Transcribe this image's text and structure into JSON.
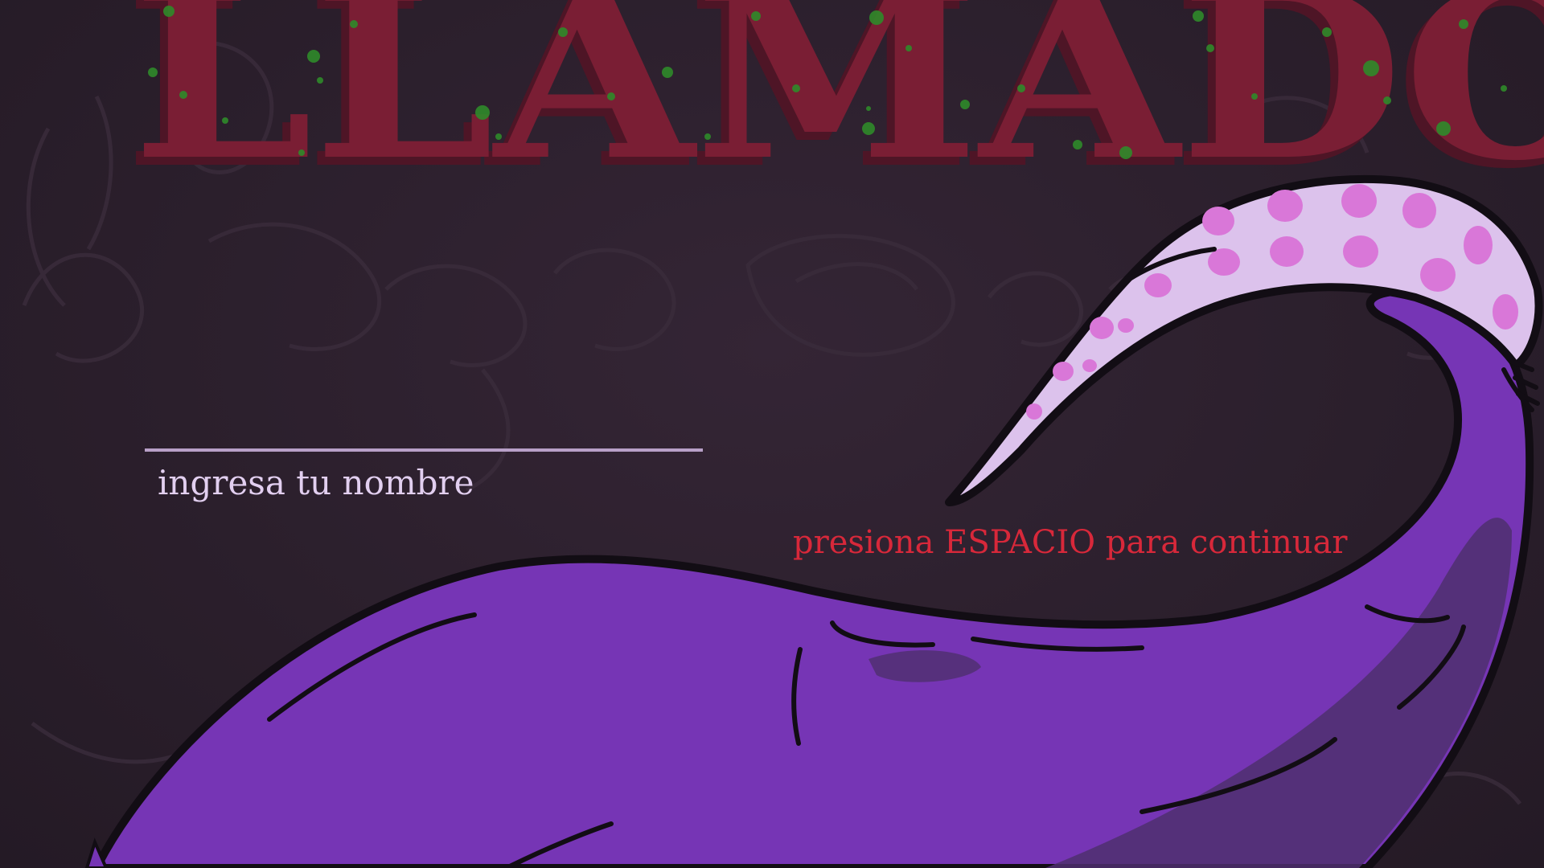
{
  "game": {
    "title_fragment": "LLAMADO",
    "name_input": {
      "value": "",
      "placeholder": "ingresa tu nombre"
    },
    "continue_hint": "presiona ESPACIO para continuar"
  },
  "colors": {
    "background": "#2b1f2c",
    "title_red": "#7a1e34",
    "title_shadow": "#4e1526",
    "paint_splatter": "#2f8a2a",
    "tentacle_body": "#7635b5",
    "tentacle_shade": "#4f2f6e",
    "tentacle_tip": "#dcc2ec",
    "tentacle_spots": "#d977d8",
    "outline": "#120d14",
    "input_text": "#e2cff0",
    "hint_text": "#d8283a"
  },
  "icons": {
    "tentacle": "tentacle-illustration",
    "background_sketches": "doodle-background"
  }
}
